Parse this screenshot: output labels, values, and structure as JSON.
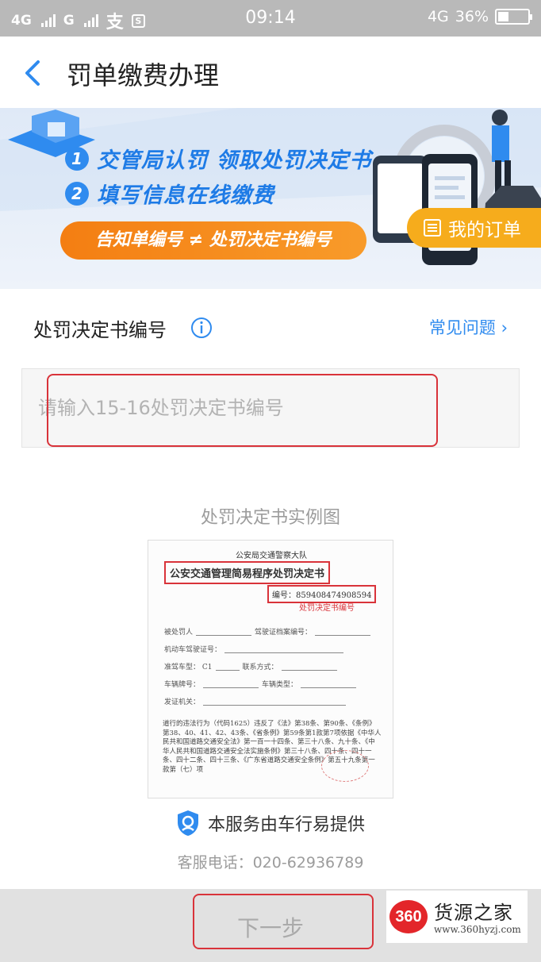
{
  "status_bar": {
    "network1": "4G",
    "network2": "G",
    "time": "09:14",
    "net_right": "4G",
    "battery": "36%",
    "battery_level": 0.36
  },
  "nav": {
    "title": "罚单缴费办理"
  },
  "banner": {
    "step1_num": "1",
    "step1": "交管局认罚 领取处罚决定书",
    "step2_num": "2",
    "step2": "填写信息在线缴费",
    "notice": "告知单编号 ≠ 处罚决定书编号",
    "my_orders": "我的订单"
  },
  "form": {
    "label": "处罚决定书编号",
    "faq": "常见问题",
    "placeholder": "请输入15-16处罚决定书编号",
    "value": ""
  },
  "example": {
    "title": "处罚决定书实例图",
    "doc_top": "公安局交通警察大队",
    "doc_title": "公安交通管理简易程序处罚决定书",
    "doc_no": "编号：859408474908594",
    "doc_note": "处罚决定书编号",
    "fields": [
      "被处罚人",
      "驾驶证档案编号：",
      "机动车驾驶证号：",
      "准驾车型：",
      "C1",
      "联系方式：",
      "车辆牌号：",
      "车辆类型：",
      "发证机关："
    ],
    "paragraph": "道行的违法行为（代码1625）违反了《法》第38条、第90条、《条例》第38、40、41、42、43条、《省条例》第59条第1款第7项依据《中华人民共和国道路交通安全法》第一百一十四条、第三十八条、九十条、《中华人民共和国道路交通安全法实施条例》第三十八条、四十条、四十一条、四十二条、四十三条、《广东省道路交通安全条例》第五十九条第一款第（七）项"
  },
  "footer": {
    "service": "本服务由车行易提供",
    "hotline": "客服电话：020-62936789",
    "next": "下一步"
  },
  "watermark": {
    "logo": "360",
    "name": "货源之家",
    "url": "www.360hyzj.com"
  },
  "colors": {
    "accent": "#2f8bef",
    "orange": "#f47e12",
    "yellow": "#f6ac1c",
    "highlight_red": "#d9333a"
  }
}
